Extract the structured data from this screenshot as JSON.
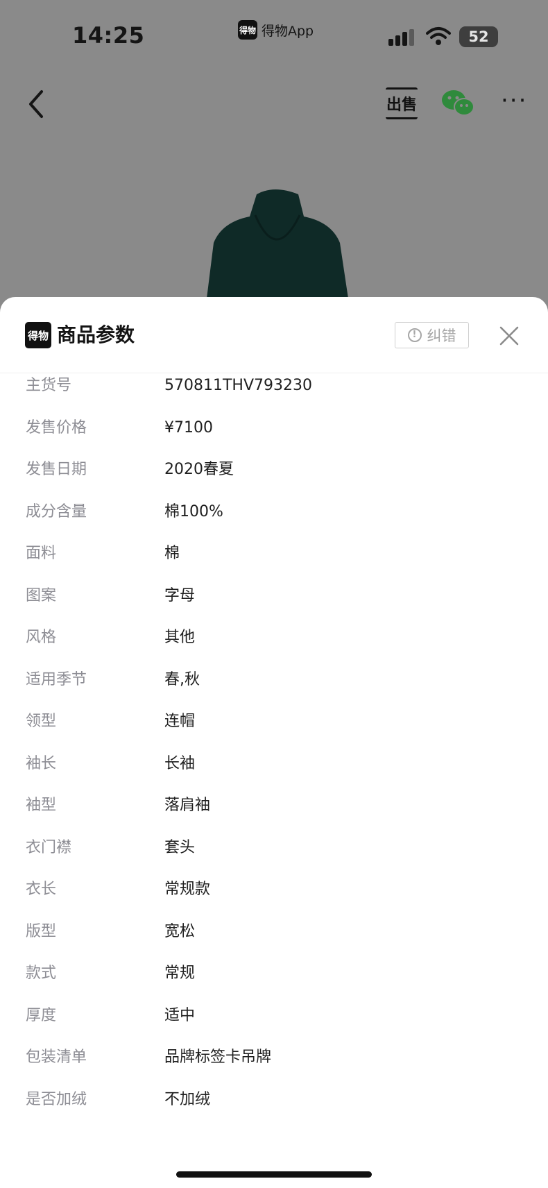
{
  "status_bar": {
    "time": "14:25",
    "app_name": "得物App",
    "app_logo_text": "得物",
    "battery": "52",
    "icons": [
      "signal-icon",
      "wifi-icon",
      "battery-icon"
    ]
  },
  "nav": {
    "back_icon": "chevron-left-icon",
    "sell_label": "出售",
    "share_icon": "wechat-icon",
    "more_label": "···"
  },
  "sheet": {
    "logo_text": "得物",
    "title": "商品参数",
    "report_label": "纠错",
    "report_icon_glyph": "!",
    "close_icon": "close-icon",
    "params": [
      {
        "label": "主货号",
        "value": "570811THV793230"
      },
      {
        "label": "发售价格",
        "value": "¥7100"
      },
      {
        "label": "发售日期",
        "value": "2020春夏"
      },
      {
        "label": "成分含量",
        "value": "棉100%"
      },
      {
        "label": "面料",
        "value": "棉"
      },
      {
        "label": "图案",
        "value": "字母"
      },
      {
        "label": "风格",
        "value": "其他"
      },
      {
        "label": "适用季节",
        "value": "春,秋"
      },
      {
        "label": "领型",
        "value": "连帽"
      },
      {
        "label": "袖长",
        "value": "长袖"
      },
      {
        "label": "袖型",
        "value": "落肩袖"
      },
      {
        "label": "衣门襟",
        "value": "套头"
      },
      {
        "label": "衣长",
        "value": "常规款"
      },
      {
        "label": "版型",
        "value": "宽松"
      },
      {
        "label": "款式",
        "value": "常规"
      },
      {
        "label": "厚度",
        "value": "适中"
      },
      {
        "label": "包装清单",
        "value": "品牌标签卡吊牌"
      },
      {
        "label": "是否加绒",
        "value": "不加绒"
      }
    ]
  },
  "colors": {
    "overlay": "#8a8a8a",
    "hoodie": "#0f2a27",
    "wechat_green": "#2f8a3c"
  }
}
